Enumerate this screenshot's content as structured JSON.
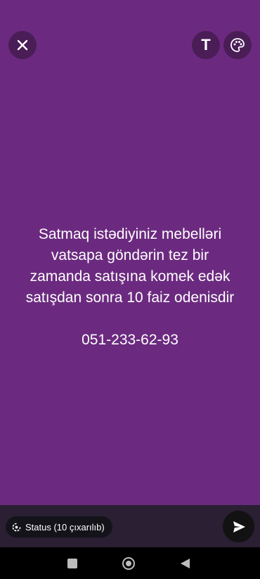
{
  "status": {
    "text": "Satmaq istədiyiniz mebelləri\nvatsapa göndərin tez bir\nzamanda satışına komek edək\nsatışdan sonra 10 faiz odenisdir\n\n051-233-62-93",
    "background_color": "#6b2a7f",
    "text_color": "#ffffff"
  },
  "toolbar": {
    "close_icon": "close-icon",
    "text_icon": "text-icon",
    "text_icon_label": "T",
    "palette_icon": "palette-icon"
  },
  "composer": {
    "audience_label": "Status (10 çıxarılıb)",
    "audience_icon": "status-icon",
    "send_icon": "send-icon"
  },
  "system_nav": {
    "back_icon": "back-icon",
    "home_icon": "home-icon",
    "recents_icon": "recents-icon"
  }
}
